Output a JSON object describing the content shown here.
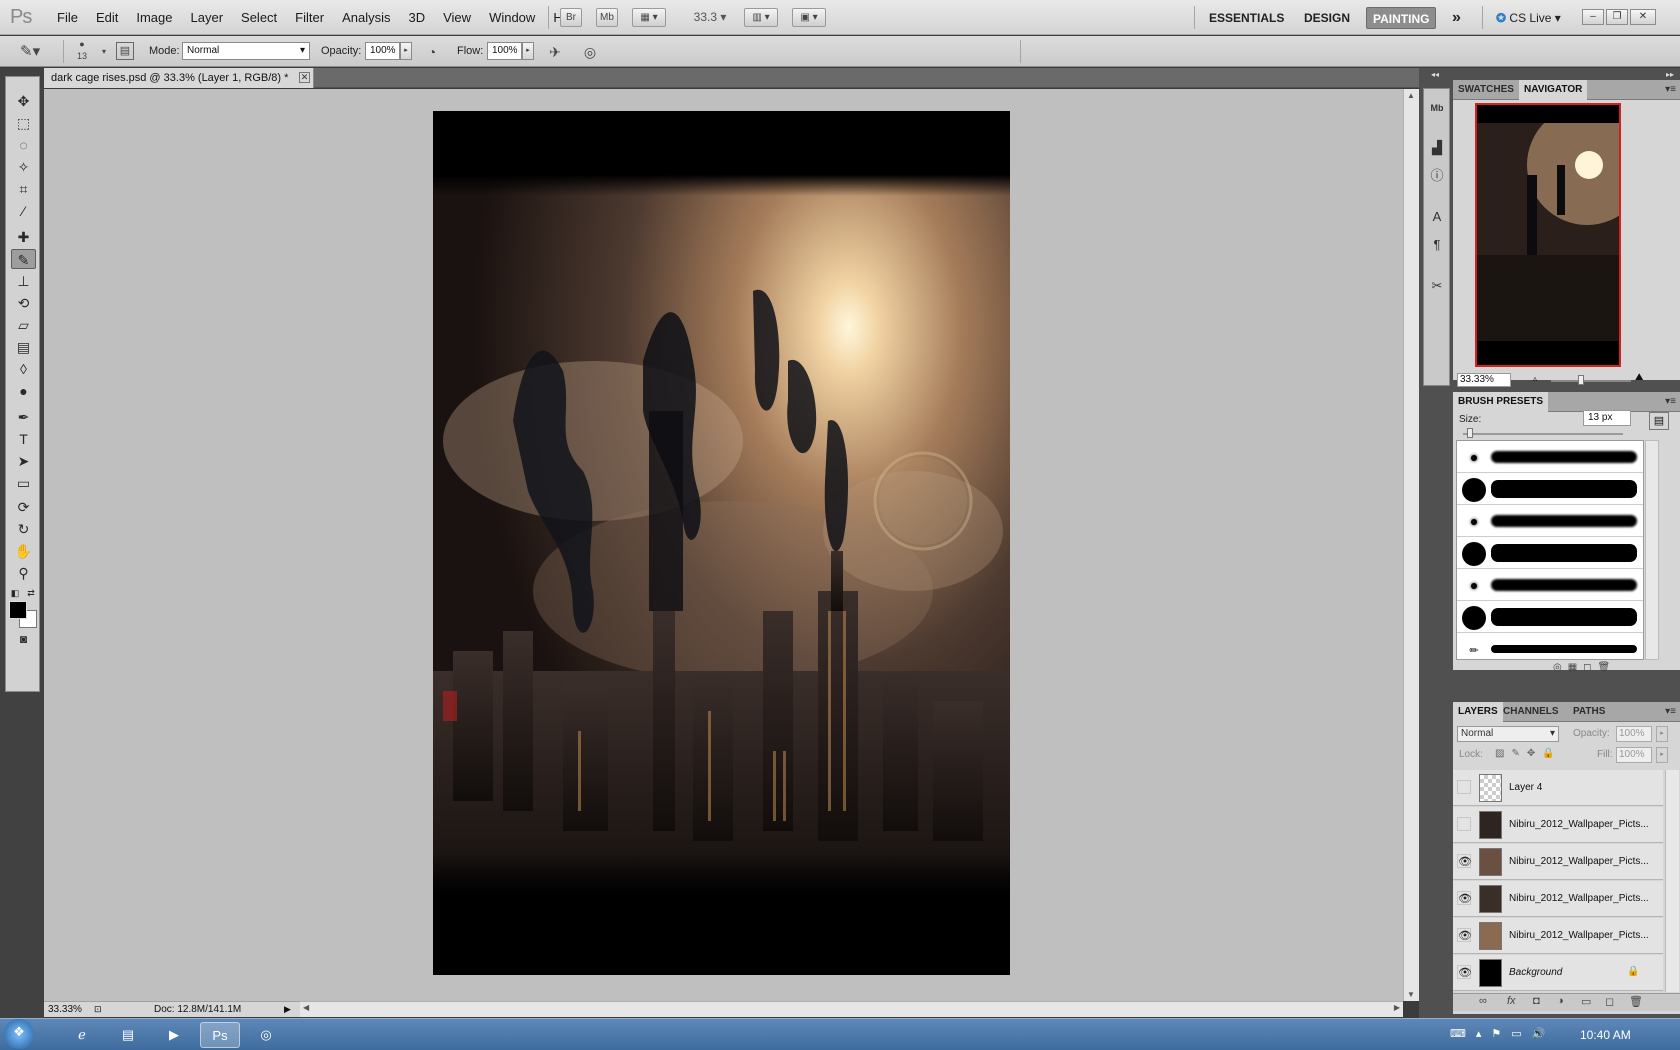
{
  "app": {
    "logo": "Ps"
  },
  "menu": [
    "File",
    "Edit",
    "Image",
    "Layer",
    "Select",
    "Filter",
    "Analysis",
    "3D",
    "View",
    "Window",
    "Help"
  ],
  "appbar": {
    "bridge": "Br",
    "minibridge": "Mb",
    "zoom": "33.3"
  },
  "workspaces": {
    "essentials": "ESSENTIALS",
    "design": "DESIGN",
    "painting": "PAINTING",
    "more": "»"
  },
  "cslive": "CS Live ▾",
  "options": {
    "brush_size": "13",
    "mode_label": "Mode:",
    "mode_value": "Normal",
    "opacity_label": "Opacity:",
    "opacity_value": "100%",
    "flow_label": "Flow:",
    "flow_value": "100%"
  },
  "document": {
    "tab_title": "dark cage rises.psd @ 33.3% (Layer 1, RGB/8) *",
    "status_zoom": "33.33%",
    "status_doc": "Doc: 12.8M/141.1M"
  },
  "navigator": {
    "tabs": [
      "SWATCHES",
      "NAVIGATOR"
    ],
    "zoom": "33.33%"
  },
  "brush_presets": {
    "title": "BRUSH PRESETS",
    "size_label": "Size:",
    "size_value": "13 px"
  },
  "layers": {
    "tabs": [
      "LAYERS",
      "CHANNELS",
      "PATHS"
    ],
    "blend_mode": "Normal",
    "opacity_label": "Opacity:",
    "opacity_value": "100%",
    "lock_label": "Lock:",
    "fill_label": "Fill:",
    "fill_value": "100%",
    "items": [
      {
        "name": "Layer 4",
        "visible": false
      },
      {
        "name": "Nibiru_2012_Wallpaper_Picts...",
        "visible": false
      },
      {
        "name": "Nibiru_2012_Wallpaper_Picts...",
        "visible": true
      },
      {
        "name": "Nibiru_2012_Wallpaper_Picts...",
        "visible": true
      },
      {
        "name": "Nibiru_2012_Wallpaper_Picts...",
        "visible": true
      },
      {
        "name": "Background",
        "visible": true
      }
    ]
  },
  "taskbar": {
    "clock": "10:40 AM"
  },
  "colors": {
    "accent": "#8d8d8d",
    "nav_frame": "#d62020",
    "taskbar": "#4a78aa"
  }
}
